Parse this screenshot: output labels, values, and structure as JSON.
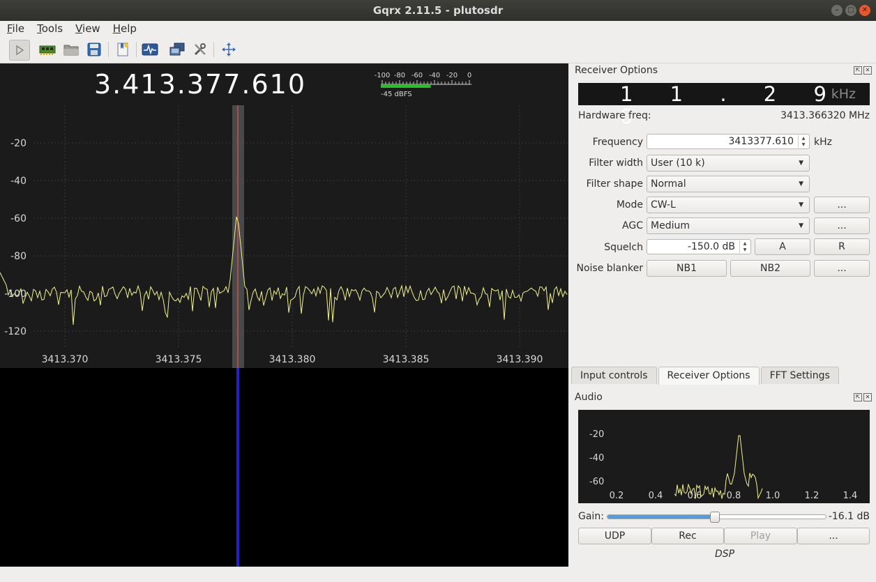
{
  "window": {
    "title": "Gqrx 2.11.5 - plutosdr"
  },
  "menu": [
    {
      "label": "File",
      "mnemonic": "F",
      "rest": "ile"
    },
    {
      "label": "Tools",
      "mnemonic": "T",
      "rest": "ools"
    },
    {
      "label": "View",
      "mnemonic": "V",
      "rest": "iew"
    },
    {
      "label": "Help",
      "mnemonic": "H",
      "rest": "elp"
    }
  ],
  "toolbar": {
    "icons": [
      "play-icon",
      "hardware-icon",
      "open-folder-icon",
      "save-icon",
      "bookmark-icon",
      "scope-icon",
      "remote-control-icon",
      "tools-icon",
      "fullscreen-icon"
    ]
  },
  "fft": {
    "frequency_display": "3.413.377.610",
    "meter_scale": [
      "-100",
      "-80",
      "-60",
      "-40",
      "-20",
      "0"
    ],
    "meter_readout": "-45 dBFS",
    "meter_level_dbfs": -45,
    "y_ticks": [
      "-20",
      "-40",
      "-60",
      "-80",
      "-100",
      "-120"
    ],
    "x_ticks": [
      "3413.370",
      "3413.375",
      "3413.380",
      "3413.385",
      "3413.390"
    ],
    "colors": {
      "trace": "#f4f48a",
      "filter_band": "#5a5a5a",
      "center_line": "#ff5a5a",
      "waterfall_signal": "#2222cc"
    }
  },
  "receiver": {
    "title": "Receiver Options",
    "offset_digits": "11.290",
    "offset_display": "1 1 . 2 9 0",
    "offset_unit": "kHz",
    "hw_label": "Hardware freq:",
    "hw_value": "3413.366320 MHz",
    "frequency_label": "Frequency",
    "frequency_value": "3413377.610",
    "frequency_unit": "kHz",
    "filter_width_label": "Filter width",
    "filter_width_value": "User (10 k)",
    "filter_shape_label": "Filter shape",
    "filter_shape_value": "Normal",
    "mode_label": "Mode",
    "mode_value": "CW-L",
    "agc_label": "AGC",
    "agc_value": "Medium",
    "squelch_label": "Squelch",
    "squelch_value": "-150.0 dB",
    "squelch_a": "A",
    "squelch_r": "R",
    "nb_label": "Noise blanker",
    "nb1": "NB1",
    "nb2": "NB2",
    "more": "..."
  },
  "tabs": [
    {
      "label": "Input controls",
      "selected": false
    },
    {
      "label": "Receiver Options",
      "selected": true
    },
    {
      "label": "FFT Settings",
      "selected": false
    }
  ],
  "audio": {
    "title": "Audio",
    "y_ticks": [
      "-20",
      "-40",
      "-60"
    ],
    "x_ticks": [
      "0.2",
      "0.4",
      "0.6",
      "0.8",
      "1.0",
      "1.2",
      "1.4"
    ],
    "gain_label": "Gain:",
    "gain_value": "-16.1 dB",
    "gain_fraction": 0.49,
    "udp": "UDP",
    "rec": "Rec",
    "play": "Play",
    "more": "...",
    "dsp": "DSP"
  }
}
